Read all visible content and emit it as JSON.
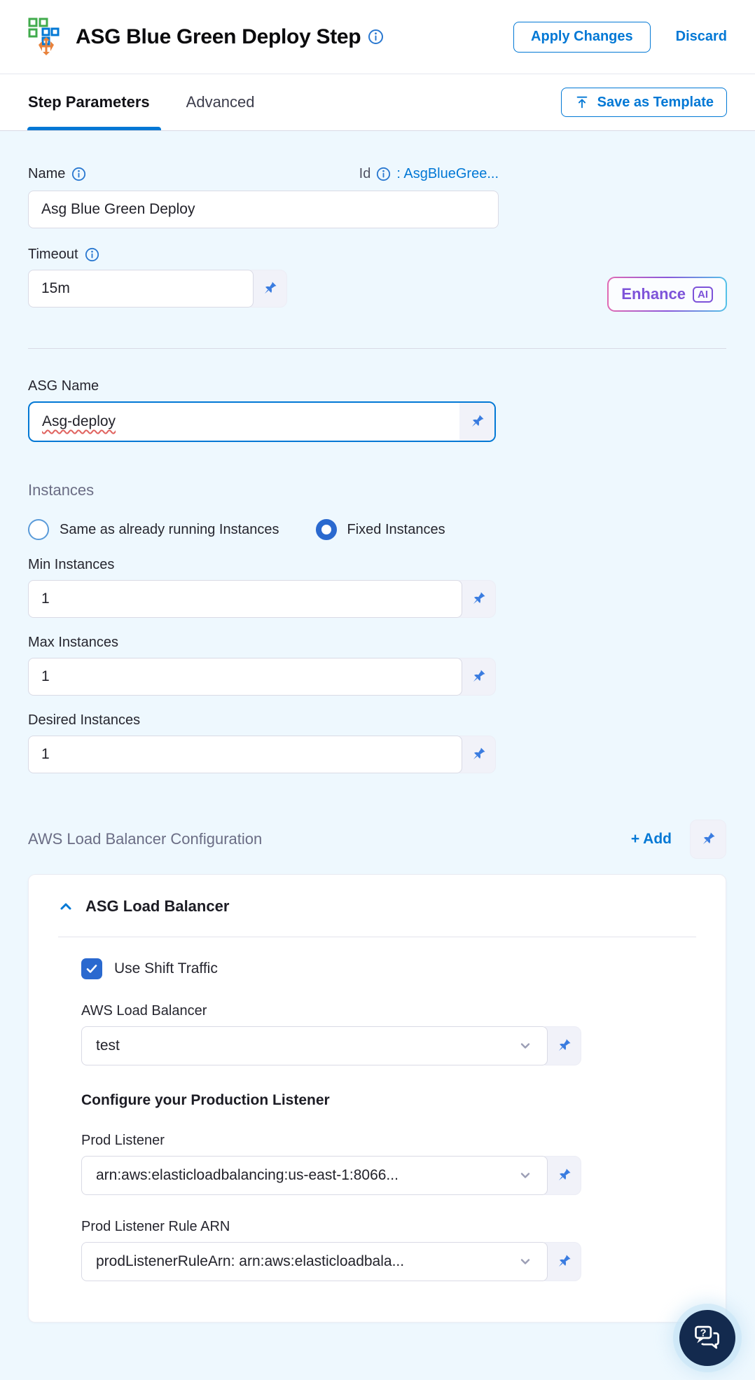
{
  "header": {
    "title": "ASG Blue Green Deploy Step",
    "apply_label": "Apply Changes",
    "discard_label": "Discard"
  },
  "tabs": {
    "step_parameters": "Step Parameters",
    "advanced": "Advanced",
    "save_as_template": "Save as Template"
  },
  "form": {
    "name": {
      "label": "Name",
      "value": "Asg Blue Green Deploy"
    },
    "id": {
      "label": "Id",
      "value": ": AsgBlueGree..."
    },
    "enhance": {
      "label": "Enhance",
      "badge": "AI"
    },
    "timeout": {
      "label": "Timeout",
      "value": "15m"
    },
    "asg_name": {
      "label": "ASG Name",
      "value": "Asg-deploy"
    },
    "instances": {
      "heading": "Instances",
      "option_same": "Same as already running Instances",
      "option_fixed": "Fixed Instances"
    },
    "min_instances": {
      "label": "Min Instances",
      "value": "1"
    },
    "max_instances": {
      "label": "Max Instances",
      "value": "1"
    },
    "desired_instances": {
      "label": "Desired Instances",
      "value": "1"
    },
    "lb_section": {
      "heading": "AWS Load Balancer Configuration",
      "add_label": "+ Add"
    },
    "lb_card": {
      "title": "ASG Load Balancer",
      "use_shift_traffic_label": "Use Shift Traffic",
      "aws_lb": {
        "label": "AWS Load Balancer",
        "value": "test"
      },
      "configure_heading": "Configure your Production Listener",
      "prod_listener": {
        "label": "Prod Listener",
        "value": "arn:aws:elasticloadbalancing:us-east-1:8066..."
      },
      "prod_listener_rule": {
        "label": "Prod Listener Rule ARN",
        "value": "prodListenerRuleArn: arn:aws:elasticloadbala..."
      }
    }
  },
  "colors": {
    "accent_blue": "#0278d5",
    "pin_blue": "#3a7ce0",
    "selected_control_blue": "#2a69cf",
    "content_background": "#eef8fe",
    "chat_fab_navy": "#132a4e",
    "enhance_gradient": [
      "#e06ab4",
      "#8a57da",
      "#54c2e8"
    ],
    "enhance_text": "#7d53d9"
  }
}
